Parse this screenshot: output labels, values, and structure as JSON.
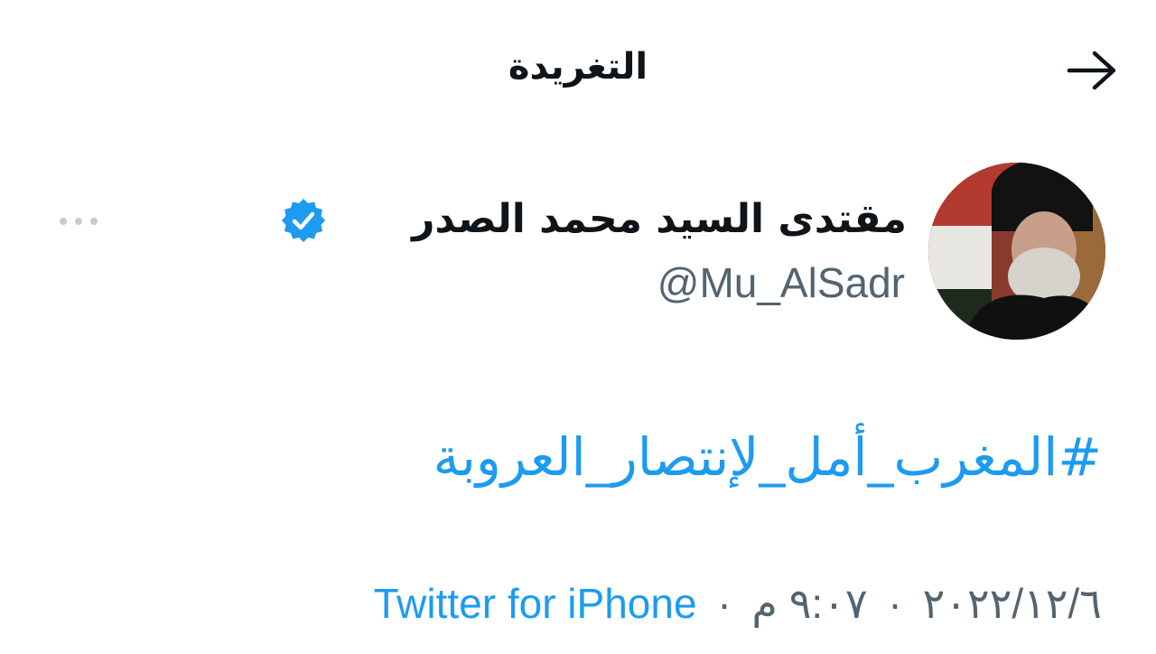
{
  "header": {
    "title": "التغريدة",
    "back_icon": "arrow-right-icon"
  },
  "tweet": {
    "author": {
      "display_name": "مقتدى السيد محمد الصدر",
      "handle": "@Mu_AlSadr",
      "verified": true,
      "verified_icon": "verified-badge-icon",
      "avatar_icon": "avatar-photo"
    },
    "more_icon": "more-options-icon",
    "text": "#المغرب_أمل_لإنتصار_العروبة",
    "date": "٢٠٢٢/١٢/٦",
    "time": "٩:٠٧ م",
    "source": "Twitter for iPhone",
    "separator": "·"
  },
  "colors": {
    "link": "#1d9bf0",
    "secondary": "#536471",
    "primary": "#0f1419",
    "background": "#ffffff"
  }
}
